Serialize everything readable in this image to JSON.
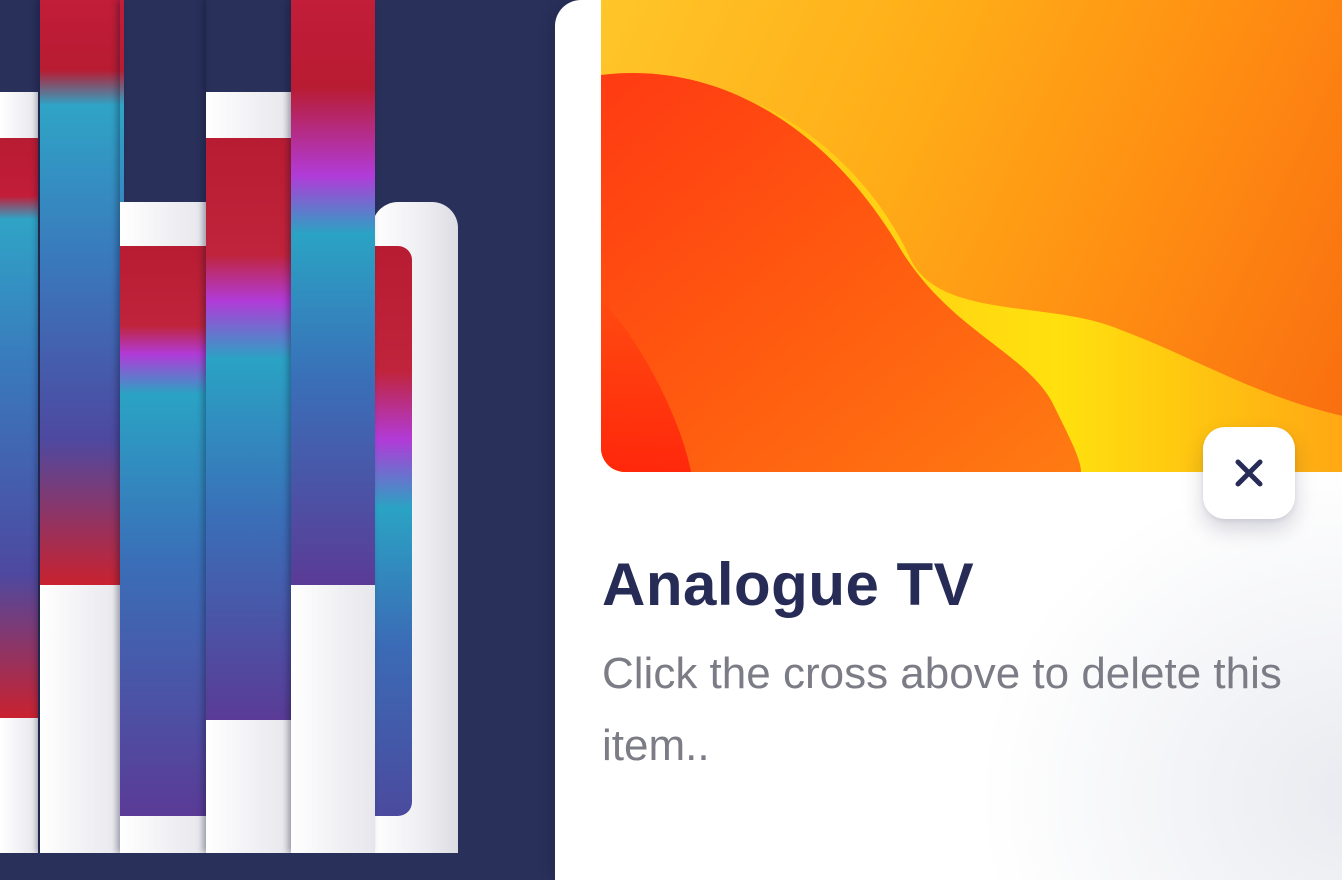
{
  "card": {
    "title": "Analogue TV",
    "description": "Click the cross above to delete this item..",
    "close_icon": "close-icon"
  },
  "colors": {
    "background": "#29305a",
    "title": "#272c57",
    "description": "#7c7c86",
    "accent_orange": "#ff8f12"
  }
}
